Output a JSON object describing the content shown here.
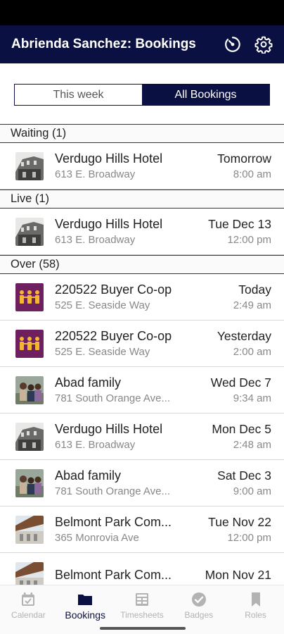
{
  "header": {
    "title": "Abrienda Sanchez: Bookings",
    "icons": [
      "timer-icon",
      "gear-icon"
    ]
  },
  "segment": {
    "tabs": [
      "This week",
      "All Bookings"
    ],
    "active_index": 1
  },
  "sections": [
    {
      "title": "Waiting (1)",
      "items": [
        {
          "icon": "hotel-building-thumb",
          "title": "Verdugo Hills Hotel",
          "subtitle": "613 E. Broadway",
          "day": "Tomorrow",
          "time": "8:00 am"
        }
      ]
    },
    {
      "title": "Live (1)",
      "items": [
        {
          "icon": "hotel-building-thumb",
          "title": "Verdugo Hills Hotel",
          "subtitle": "613 E. Broadway",
          "day": "Tue Dec 13",
          "time": "12:00 pm"
        }
      ]
    },
    {
      "title": "Over (58)",
      "items": [
        {
          "icon": "people-group-thumb",
          "title": "220522 Buyer Co-op",
          "subtitle": "525 E. Seaside Way",
          "day": "Today",
          "time": "2:49 am"
        },
        {
          "icon": "people-group-thumb",
          "title": "220522 Buyer Co-op",
          "subtitle": "525 E. Seaside Way",
          "day": "Yesterday",
          "time": "2:00 am"
        },
        {
          "icon": "family-photo-thumb",
          "title": "Abad family",
          "subtitle": "781 South Orange Ave...",
          "day": "Wed Dec 7",
          "time": "9:34 am"
        },
        {
          "icon": "hotel-building-thumb",
          "title": "Verdugo Hills Hotel",
          "subtitle": "613 E. Broadway",
          "day": "Mon Dec 5",
          "time": "2:48 am"
        },
        {
          "icon": "family-photo-thumb",
          "title": "Abad family",
          "subtitle": "781 South Orange Ave...",
          "day": "Sat Dec 3",
          "time": "9:00 am"
        },
        {
          "icon": "park-building-thumb",
          "title": "Belmont Park Com...",
          "subtitle": "365 Monrovia Ave",
          "day": "Tue Nov 22",
          "time": "12:00 pm"
        },
        {
          "icon": "park-building-thumb",
          "title": "Belmont Park Com...",
          "subtitle": "",
          "day": "Mon Nov 21",
          "time": ""
        }
      ]
    }
  ],
  "bottom_nav": [
    {
      "label": "Calendar",
      "icon": "calendar-icon",
      "active": false
    },
    {
      "label": "Bookings",
      "icon": "folder-icon",
      "active": true
    },
    {
      "label": "Timesheets",
      "icon": "timesheet-icon",
      "active": false
    },
    {
      "label": "Badges",
      "icon": "badge-check-icon",
      "active": false
    },
    {
      "label": "Roles",
      "icon": "bookmark-icon",
      "active": false
    }
  ],
  "colors": {
    "navy": "#0a1142",
    "purple_thumb": "#6d1f5f",
    "gold": "#f2b631",
    "inactive": "#b3b3b3"
  }
}
